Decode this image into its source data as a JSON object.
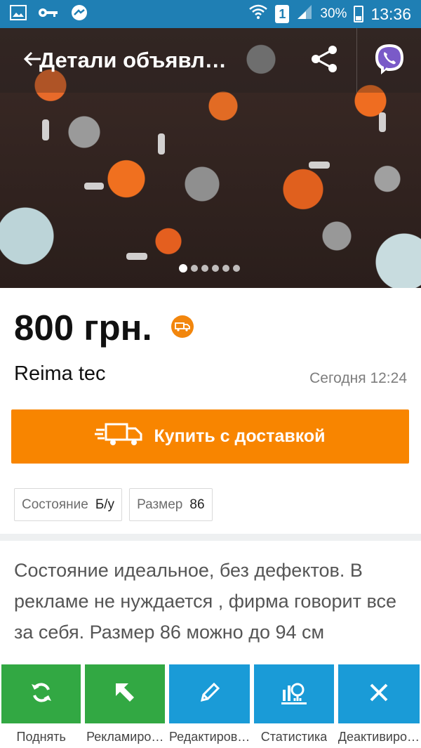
{
  "status_bar": {
    "battery_percent": "30%",
    "sim_slot": "1",
    "time": "13:36",
    "icons": [
      "gallery-icon",
      "key-icon",
      "tool-icon",
      "wifi-icon",
      "signal-icon",
      "battery-icon"
    ]
  },
  "header": {
    "title": "Детали объявл…",
    "back_icon": "arrow-left-icon",
    "share_icon": "share-icon",
    "viber_icon": "viber-icon"
  },
  "gallery": {
    "photo_count": 6,
    "active_index": 0
  },
  "listing": {
    "price": "800 грн.",
    "delivery_badge_icon": "delivery-truck-icon",
    "title": "Reima tec",
    "date": "Сегодня 12:24",
    "buy_button": "Купить с доставкой",
    "params": [
      {
        "label": "Состояние",
        "value": "Б/у"
      },
      {
        "label": "Размер",
        "value": "86"
      }
    ],
    "description": "Состояние идеальное, без дефектов. В рекламе не нуждается , фирма говорит все за себя. Размер 86 можно до 94 см"
  },
  "actions": [
    {
      "label": "Поднять",
      "icon": "refresh-icon",
      "color": "#32a843"
    },
    {
      "label": "Рекламиро…",
      "icon": "arrow-up-left-icon",
      "color": "#32a843"
    },
    {
      "label": "Редактиров…",
      "icon": "pencil-icon",
      "color": "#1a9bd7"
    },
    {
      "label": "Статистика",
      "icon": "statistics-icon",
      "color": "#1a9bd7"
    },
    {
      "label": "Деактивиро…",
      "icon": "close-icon",
      "color": "#1a9bd7"
    }
  ],
  "colors": {
    "status_bar": "#1f7fb4",
    "accent_orange": "#f88500",
    "action_green": "#32a843",
    "action_blue": "#1a9bd7"
  }
}
